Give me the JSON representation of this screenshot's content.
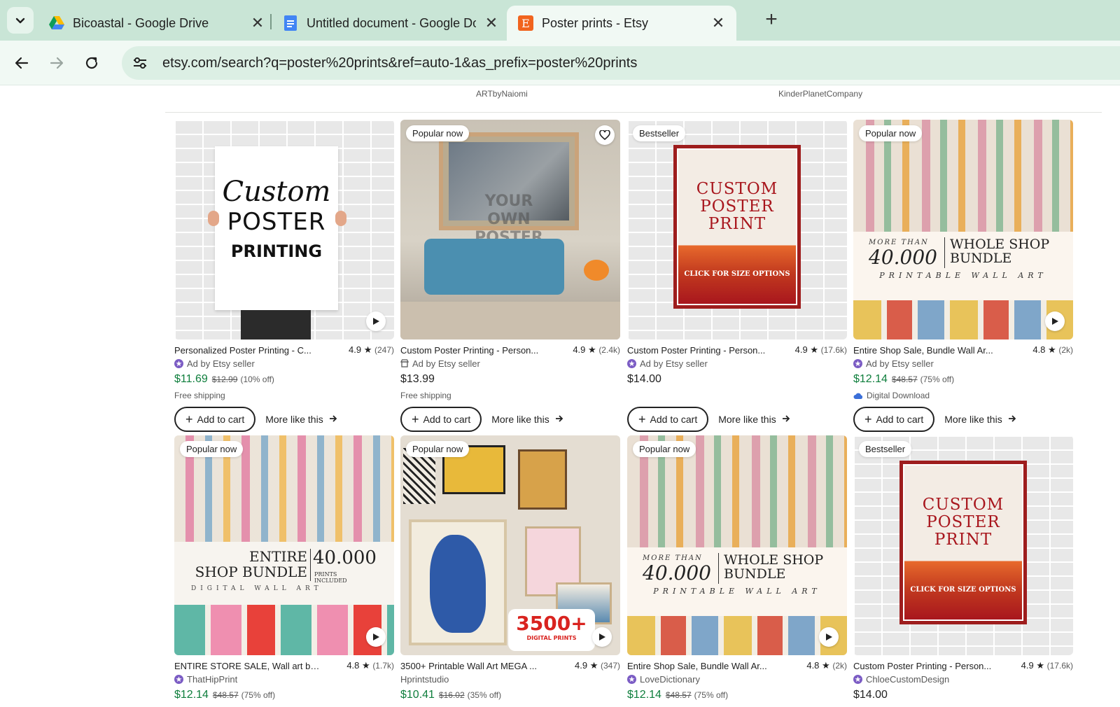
{
  "tabs": [
    {
      "title": "Bicoastal - Google Drive",
      "icon": "google-drive-icon"
    },
    {
      "title": "Untitled document - Google Docs",
      "icon": "google-docs-icon"
    },
    {
      "title": "Poster prints - Etsy",
      "icon": "etsy-icon",
      "active": true
    }
  ],
  "toolbar": {
    "url": "etsy.com/search?q=poster%20prints&ref=auto-1&as_prefix=poster%20prints"
  },
  "previous_row_shops": [
    "ARTbyNaiomi",
    "KinderPlanetCompany"
  ],
  "colors": {
    "sale_price": "#0e7e3c",
    "star_seller_badge": "#7b5cc4",
    "tab_strip": "#c9e5d6"
  },
  "cards": [
    {
      "badge": "",
      "title": "Personalized Poster Printing - C...",
      "rating": "4.9",
      "reviews": "(247)",
      "seller": "Ad by Etsy seller",
      "seller_icon": "star-seller-icon",
      "price": "$11.69",
      "original_price": "$12.99",
      "discount": "(10% off)",
      "extra": "Free shipping",
      "image_text": {
        "line1": "Custom",
        "line2": "POSTER",
        "line3": "PRINTING"
      },
      "add_to_cart": "Add to cart",
      "more_like_this": "More like this"
    },
    {
      "badge": "Popular now",
      "title": "Custom Poster Printing - Person...",
      "rating": "4.9",
      "reviews": "(2.4k)",
      "seller": "Ad by Etsy seller",
      "seller_icon": "shop-icon",
      "price": "$13.99",
      "original_price": "",
      "discount": "",
      "extra": "Free shipping",
      "image_text": {
        "line1": "YOUR",
        "line2": "OWN",
        "line3": "POSTER"
      },
      "add_to_cart": "Add to cart",
      "more_like_this": "More like this"
    },
    {
      "badge": "Bestseller",
      "title": "Custom Poster Printing - Person...",
      "rating": "4.9",
      "reviews": "(17.6k)",
      "seller": "Ad by Etsy seller",
      "seller_icon": "star-seller-icon",
      "price": "$14.00",
      "original_price": "",
      "discount": "",
      "extra": "",
      "image_text": {
        "line1": "CUSTOM",
        "line2": "POSTER",
        "line3": "PRINT",
        "cta": "CLICK FOR SIZE OPTIONS"
      },
      "add_to_cart": "Add to cart",
      "more_like_this": "More like this"
    },
    {
      "badge": "Popular now",
      "title": "Entire Shop Sale, Bundle Wall Ar...",
      "rating": "4.8",
      "reviews": "(2k)",
      "seller": "Ad by Etsy seller",
      "seller_icon": "star-seller-icon",
      "price": "$12.14",
      "original_price": "$48.57",
      "discount": "(75% off)",
      "extra": "Digital Download",
      "image_text": {
        "small": "MORE THAN",
        "big": "40.000",
        "line1": "WHOLE SHOP",
        "line2": "BUNDLE",
        "sub": "PRINTABLE WALL ART"
      },
      "add_to_cart": "Add to cart",
      "more_like_this": "More like this"
    },
    {
      "badge": "Popular now",
      "title": "ENTIRE STORE SALE, Wall art bu...",
      "rating": "4.8",
      "reviews": "(1.7k)",
      "seller": "ThatHipPrint",
      "seller_icon": "star-seller-icon",
      "price": "$12.14",
      "original_price": "$48.57",
      "discount": "(75% off)",
      "image_text": {
        "line1": "ENTIRE",
        "line2": "SHOP BUNDLE",
        "big": "40.000",
        "side": "PRINTS INCLUDED",
        "sub": "DIGITAL WALL ART"
      }
    },
    {
      "badge": "Popular now",
      "title": "3500+ Printable Wall Art MEGA ...",
      "rating": "4.9",
      "reviews": "(347)",
      "seller": "Hprintstudio",
      "seller_icon": "",
      "price": "$10.41",
      "original_price": "$16.02",
      "discount": "(35% off)",
      "image_text": {
        "big": "3500+",
        "sub": "DIGITAL PRINTS"
      }
    },
    {
      "badge": "Popular now",
      "title": "Entire Shop Sale, Bundle Wall Ar...",
      "rating": "4.8",
      "reviews": "(2k)",
      "seller": "LoveDictionary",
      "seller_icon": "star-seller-icon",
      "price": "$12.14",
      "original_price": "$48.57",
      "discount": "(75% off)",
      "image_text": {
        "small": "MORE THAN",
        "big": "40.000",
        "line1": "WHOLE SHOP",
        "line2": "BUNDLE",
        "sub": "PRINTABLE WALL ART"
      }
    },
    {
      "badge": "Bestseller",
      "title": "Custom Poster Printing - Person...",
      "rating": "4.9",
      "reviews": "(17.6k)",
      "seller": "ChloeCustomDesign",
      "seller_icon": "star-seller-icon",
      "price": "$14.00",
      "original_price": "",
      "discount": "",
      "image_text": {
        "line1": "CUSTOM",
        "line2": "POSTER",
        "line3": "PRINT",
        "cta": "CLICK FOR SIZE OPTIONS"
      }
    }
  ]
}
